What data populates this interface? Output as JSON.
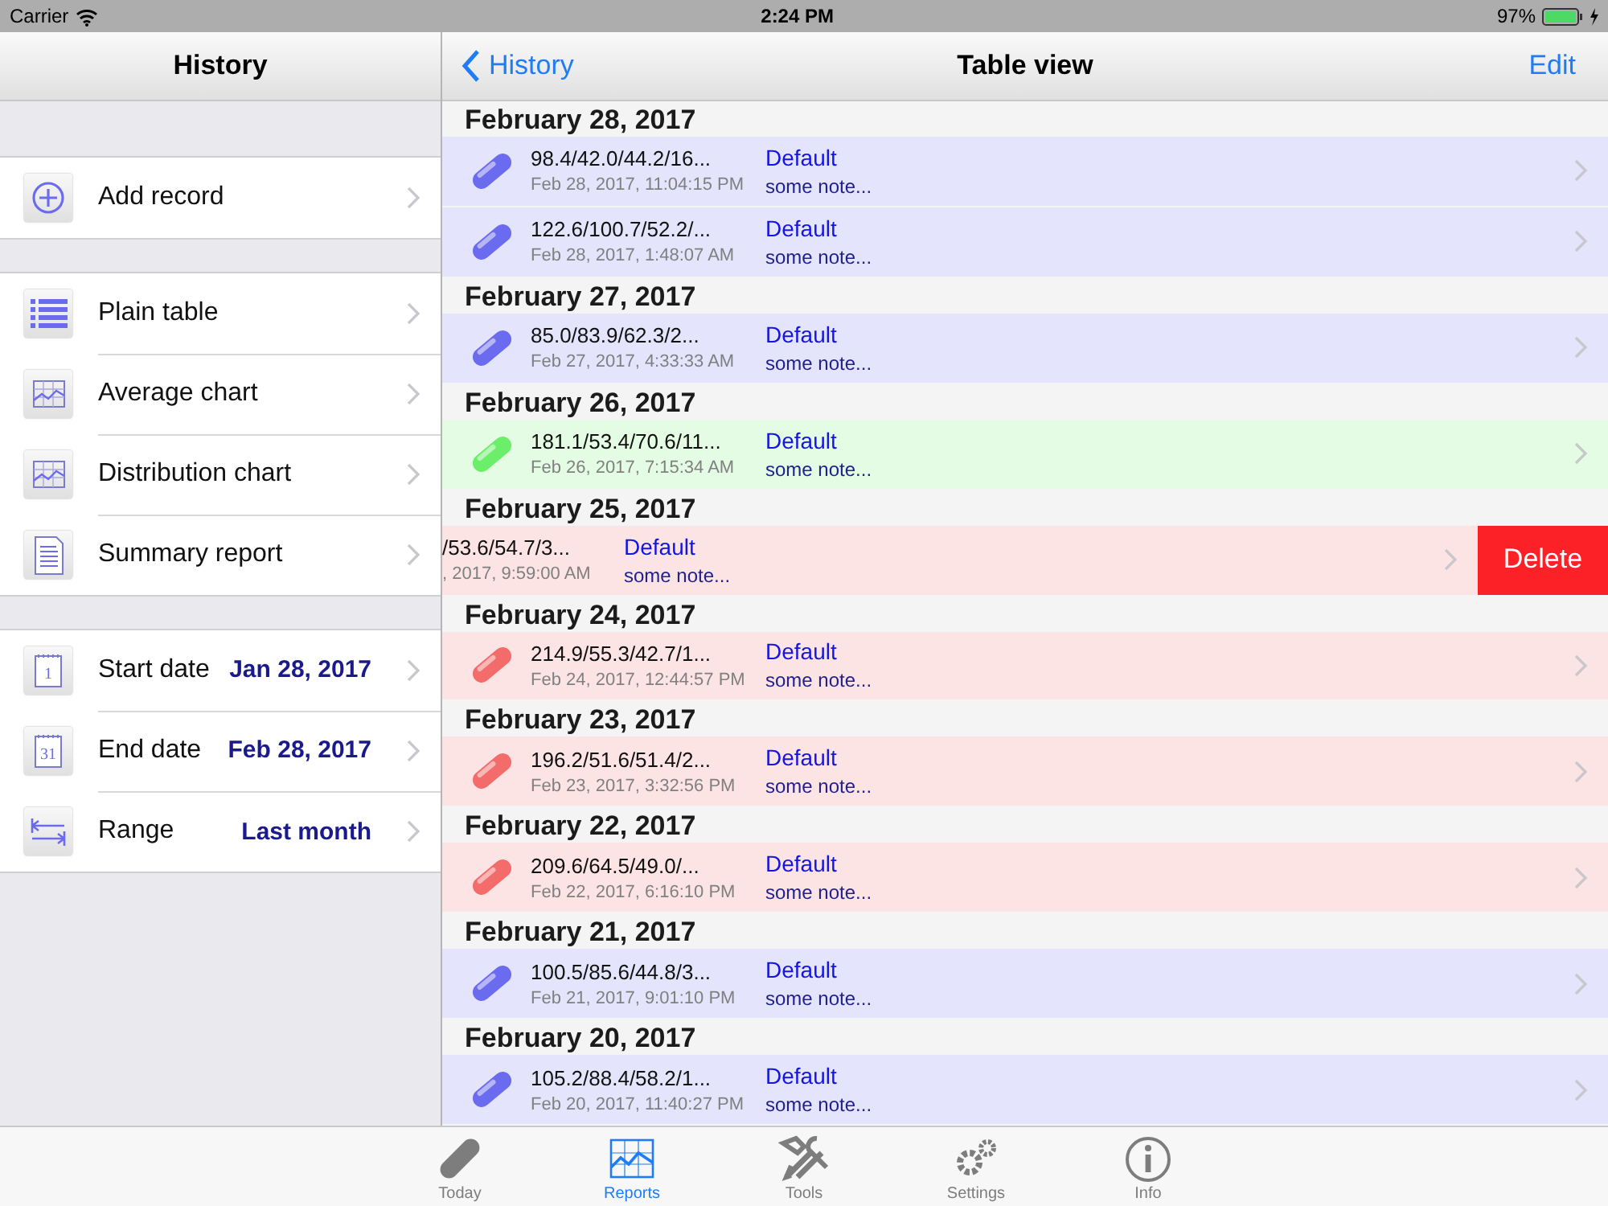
{
  "status_bar": {
    "carrier": "Carrier",
    "time": "2:24 PM",
    "battery": "97%"
  },
  "sidebar": {
    "title": "History",
    "groups": [
      {
        "items": [
          {
            "label": "Add record"
          }
        ]
      },
      {
        "items": [
          {
            "label": "Plain table"
          },
          {
            "label": "Average chart"
          },
          {
            "label": "Distribution chart"
          },
          {
            "label": "Summary report"
          }
        ]
      },
      {
        "items": [
          {
            "label": "Start date",
            "value": "Jan 28, 2017",
            "icon_text": "1"
          },
          {
            "label": "End date",
            "value": "Feb 28, 2017",
            "icon_text": "31"
          },
          {
            "label": "Range",
            "value": "Last month"
          }
        ]
      }
    ]
  },
  "detail": {
    "back": "History",
    "title": "Table view",
    "edit": "Edit",
    "sections": [
      {
        "header": "February 28, 2017",
        "records": [
          {
            "values": "98.4/42.0/44.2/16...",
            "time": "Feb 28, 2017, 11:04:15 PM",
            "category": "Default",
            "note": "some note...",
            "color": "#e4e4fc",
            "swiped": false
          },
          {
            "values": "122.6/100.7/52.2/...",
            "time": "Feb 28, 2017, 1:48:07 AM",
            "category": "Default",
            "note": "some note...",
            "color": "#e4e4fc",
            "swiped": false
          }
        ]
      },
      {
        "header": "February 27, 2017",
        "records": [
          {
            "values": "85.0/83.9/62.3/2...",
            "time": "Feb 27, 2017, 4:33:33 AM",
            "category": "Default",
            "note": "some note...",
            "color": "#e4e4fc",
            "swiped": false
          }
        ]
      },
      {
        "header": "February 26, 2017",
        "records": [
          {
            "values": "181.1/53.4/70.6/11...",
            "time": "Feb 26, 2017, 7:15:34 AM",
            "category": "Default",
            "note": "some note...",
            "color": "#e4fce4",
            "swiped": false
          }
        ]
      },
      {
        "header": "February 25, 2017",
        "records": [
          {
            "values": "/53.6/54.7/3...",
            "time": ", 2017, 9:59:00 AM",
            "category": "Default",
            "note": "some note...",
            "color": "#fde4e4",
            "swiped": true,
            "action": "Delete"
          }
        ]
      },
      {
        "header": "February 24, 2017",
        "records": [
          {
            "values": "214.9/55.3/42.7/1...",
            "time": "Feb 24, 2017, 12:44:57 PM",
            "category": "Default",
            "note": "some note...",
            "color": "#fde4e4",
            "swiped": false
          }
        ]
      },
      {
        "header": "February 23, 2017",
        "records": [
          {
            "values": "196.2/51.6/51.4/2...",
            "time": "Feb 23, 2017, 3:32:56 PM",
            "category": "Default",
            "note": "some note...",
            "color": "#fde4e4",
            "swiped": false
          }
        ]
      },
      {
        "header": "February 22, 2017",
        "records": [
          {
            "values": "209.6/64.5/49.0/...",
            "time": "Feb 22, 2017, 6:16:10 PM",
            "category": "Default",
            "note": "some note...",
            "color": "#fde4e4",
            "swiped": false
          }
        ]
      },
      {
        "header": "February 21, 2017",
        "records": [
          {
            "values": "100.5/85.6/44.8/3...",
            "time": "Feb 21, 2017, 9:01:10 PM",
            "category": "Default",
            "note": "some note...",
            "color": "#e4e4fc",
            "swiped": false
          }
        ]
      },
      {
        "header": "February 20, 2017",
        "records": [
          {
            "values": "105.2/88.4/58.2/1...",
            "time": "Feb 20, 2017, 11:40:27 PM",
            "category": "Default",
            "note": "some note...",
            "color": "#e4e4fc",
            "swiped": false
          }
        ]
      }
    ]
  },
  "tab_bar": [
    {
      "label": "Today",
      "selected": false
    },
    {
      "label": "Reports",
      "selected": true
    },
    {
      "label": "Tools",
      "selected": false
    },
    {
      "label": "Settings",
      "selected": false
    },
    {
      "label": "Info",
      "selected": false
    }
  ]
}
